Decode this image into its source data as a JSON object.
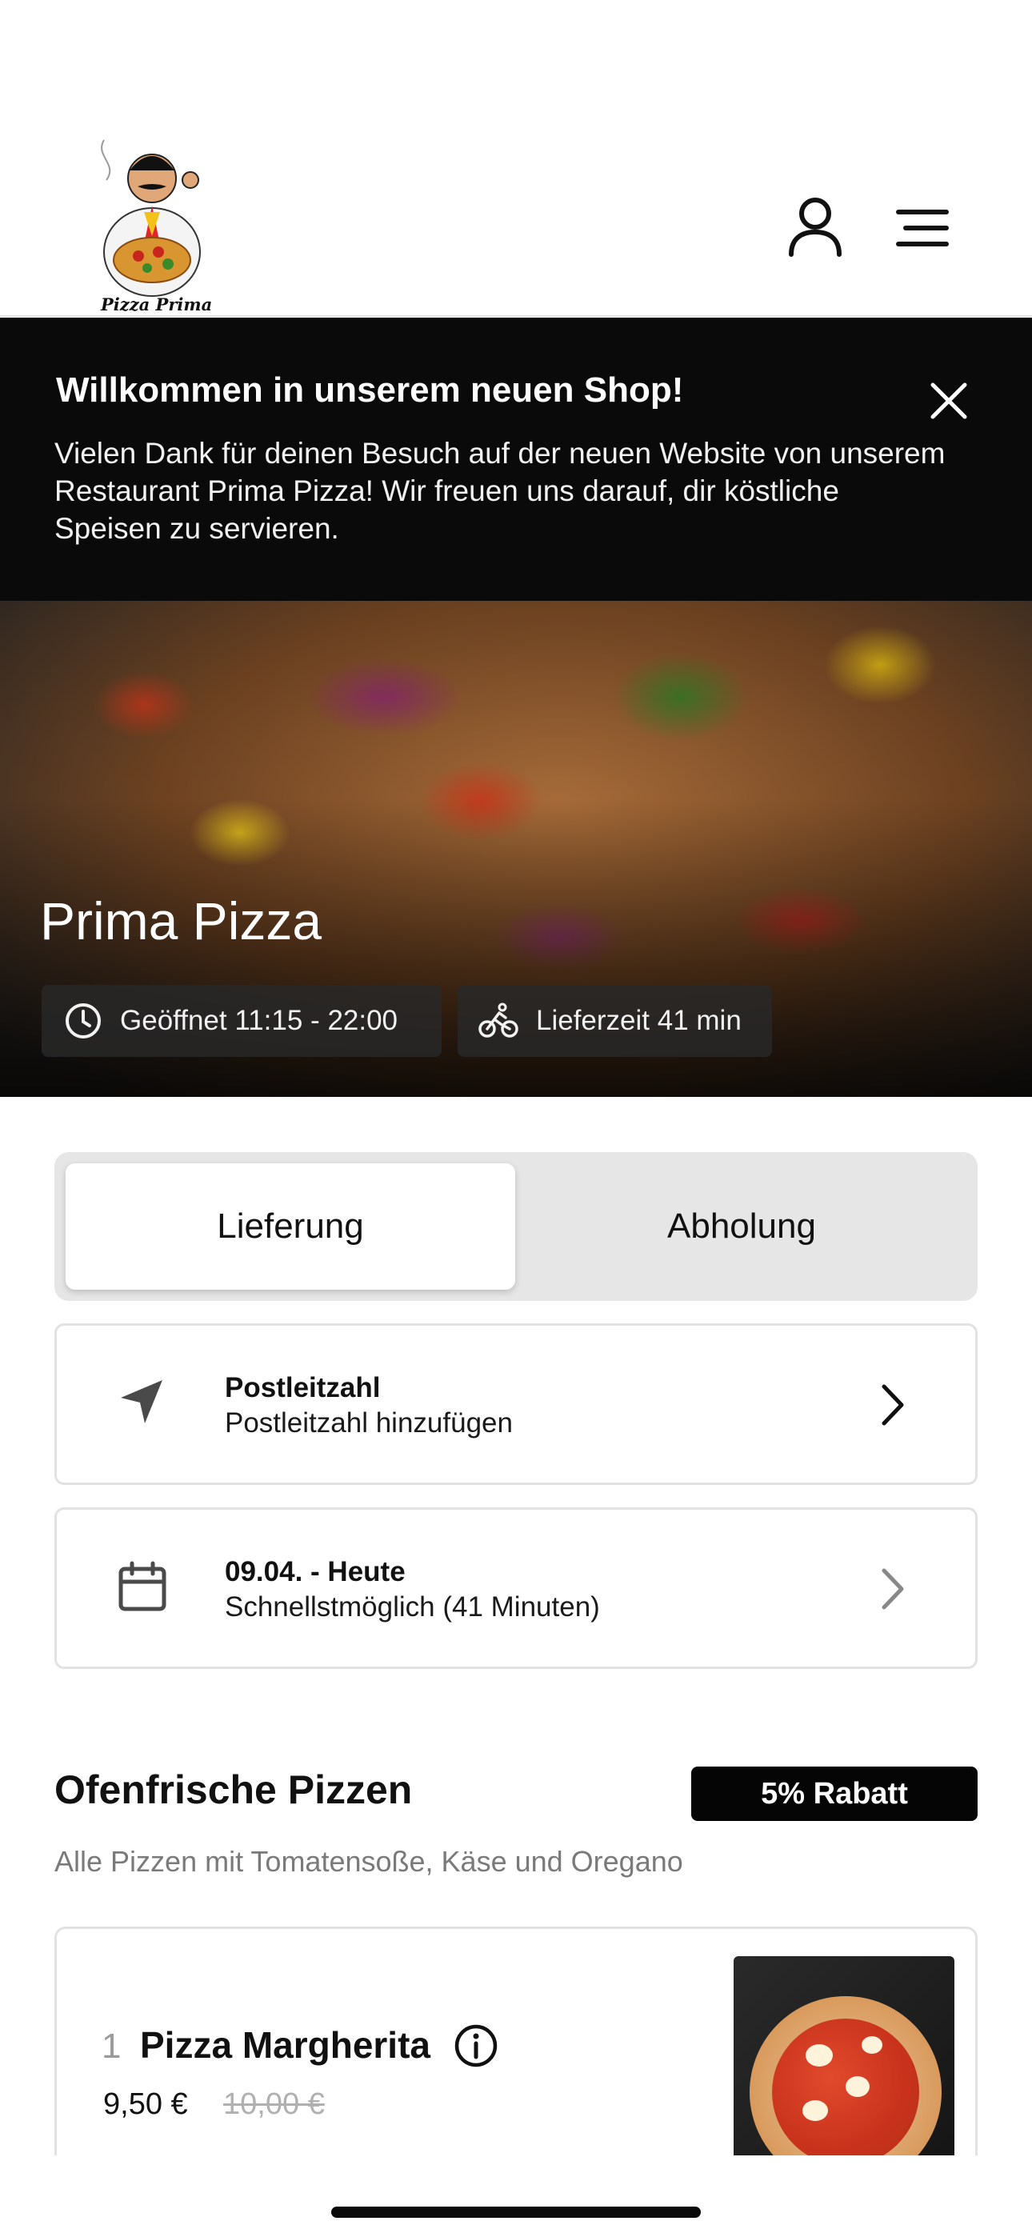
{
  "header": {
    "logo_text": "Pizza Prima",
    "account_icon": "user-icon",
    "menu_icon": "menu-icon"
  },
  "banner": {
    "title": "Willkommen in unserem neuen Shop!",
    "text": "Vielen Dank für deinen Besuch auf der neuen Website von unserem Restaurant Prima Pizza! Wir freuen uns darauf, dir köstliche Speisen zu servieren.",
    "close_icon": "close-icon"
  },
  "hero": {
    "title": "Prima Pizza",
    "opening_hours": "Geöffnet 11:15 - 22:00",
    "delivery_time": "Lieferzeit 41 min"
  },
  "order_type": {
    "options": [
      "Lieferung",
      "Abholung"
    ],
    "selected": "Lieferung"
  },
  "zip_card": {
    "title": "Postleitzahl",
    "subtitle": "Postleitzahl hinzufügen",
    "icon": "location-arrow-icon"
  },
  "date_card": {
    "title": "09.04. - Heute",
    "subtitle": "Schnellstmöglich (41 Minuten)",
    "icon": "calendar-icon"
  },
  "section": {
    "title": "Ofenfrische Pizzen",
    "badge": "5% Rabatt",
    "subtitle": "Alle Pizzen mit Tomatensoße, Käse und Oregano"
  },
  "products": [
    {
      "number": "1",
      "name": "Pizza Margherita",
      "price": "9,50 €",
      "old_price": "10,00 €"
    }
  ],
  "colors": {
    "banner_bg": "#0a0a0a",
    "badge_bg": "#050505",
    "toggle_bg": "#e6e6e6"
  }
}
